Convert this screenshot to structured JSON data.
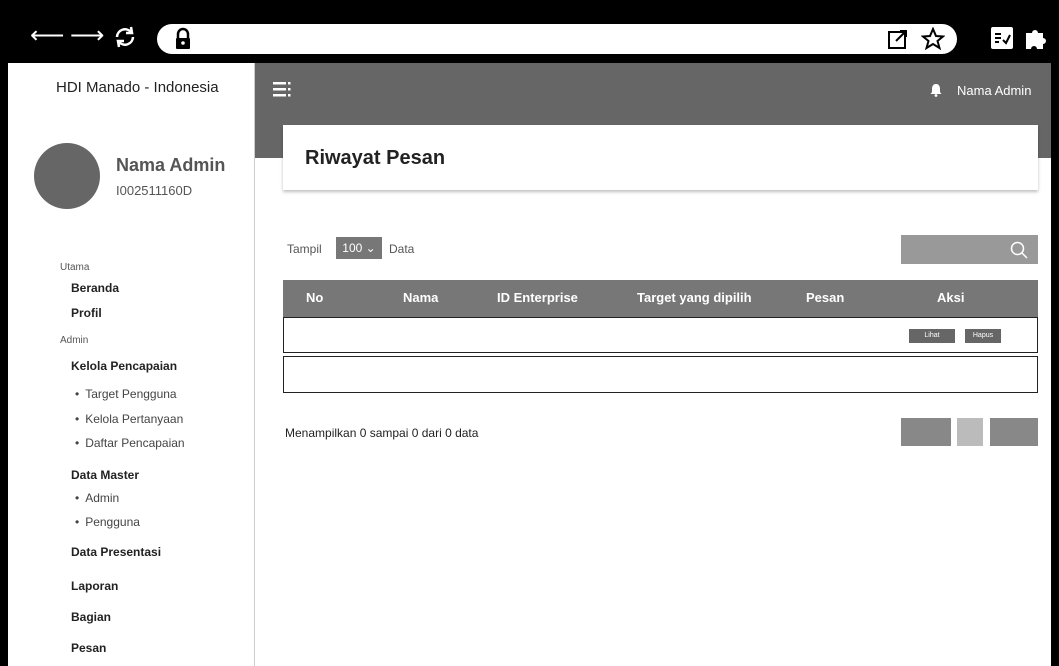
{
  "browser": {
    "lock_icon": "lock-icon"
  },
  "sidebar": {
    "brand": "HDI Manado - Indonesia",
    "admin_name": "Nama Admin",
    "admin_id": "I002511160D",
    "section_main": "Utama",
    "home": "Beranda",
    "profile": "Profil",
    "section_admin": "Admin",
    "achievements": "Kelola Pencapaian",
    "sub_target": "Target Pengguna",
    "sub_questions": "Kelola Pertanyaan",
    "sub_list": "Daftar Pencapaian",
    "master": "Data Master",
    "sub_admin": "Admin",
    "sub_user": "Pengguna",
    "presentation": "Data Presentasi",
    "report": "Laporan",
    "division": "Bagian",
    "message": "Pesan"
  },
  "header": {
    "admin": "Nama Admin"
  },
  "main": {
    "title": "Riwayat Pesan",
    "show_label": "Tampil",
    "show_value": "100 ⌄",
    "data_label": "Data",
    "columns": [
      "No",
      "Nama",
      "ID Enterprise",
      "Target yang dipilih",
      "Pesan",
      "Aksi"
    ],
    "view_label": "Lihat",
    "delete_label": "Hapus",
    "footer": "Menampilkan 0 sampai 0 dari 0 data"
  }
}
